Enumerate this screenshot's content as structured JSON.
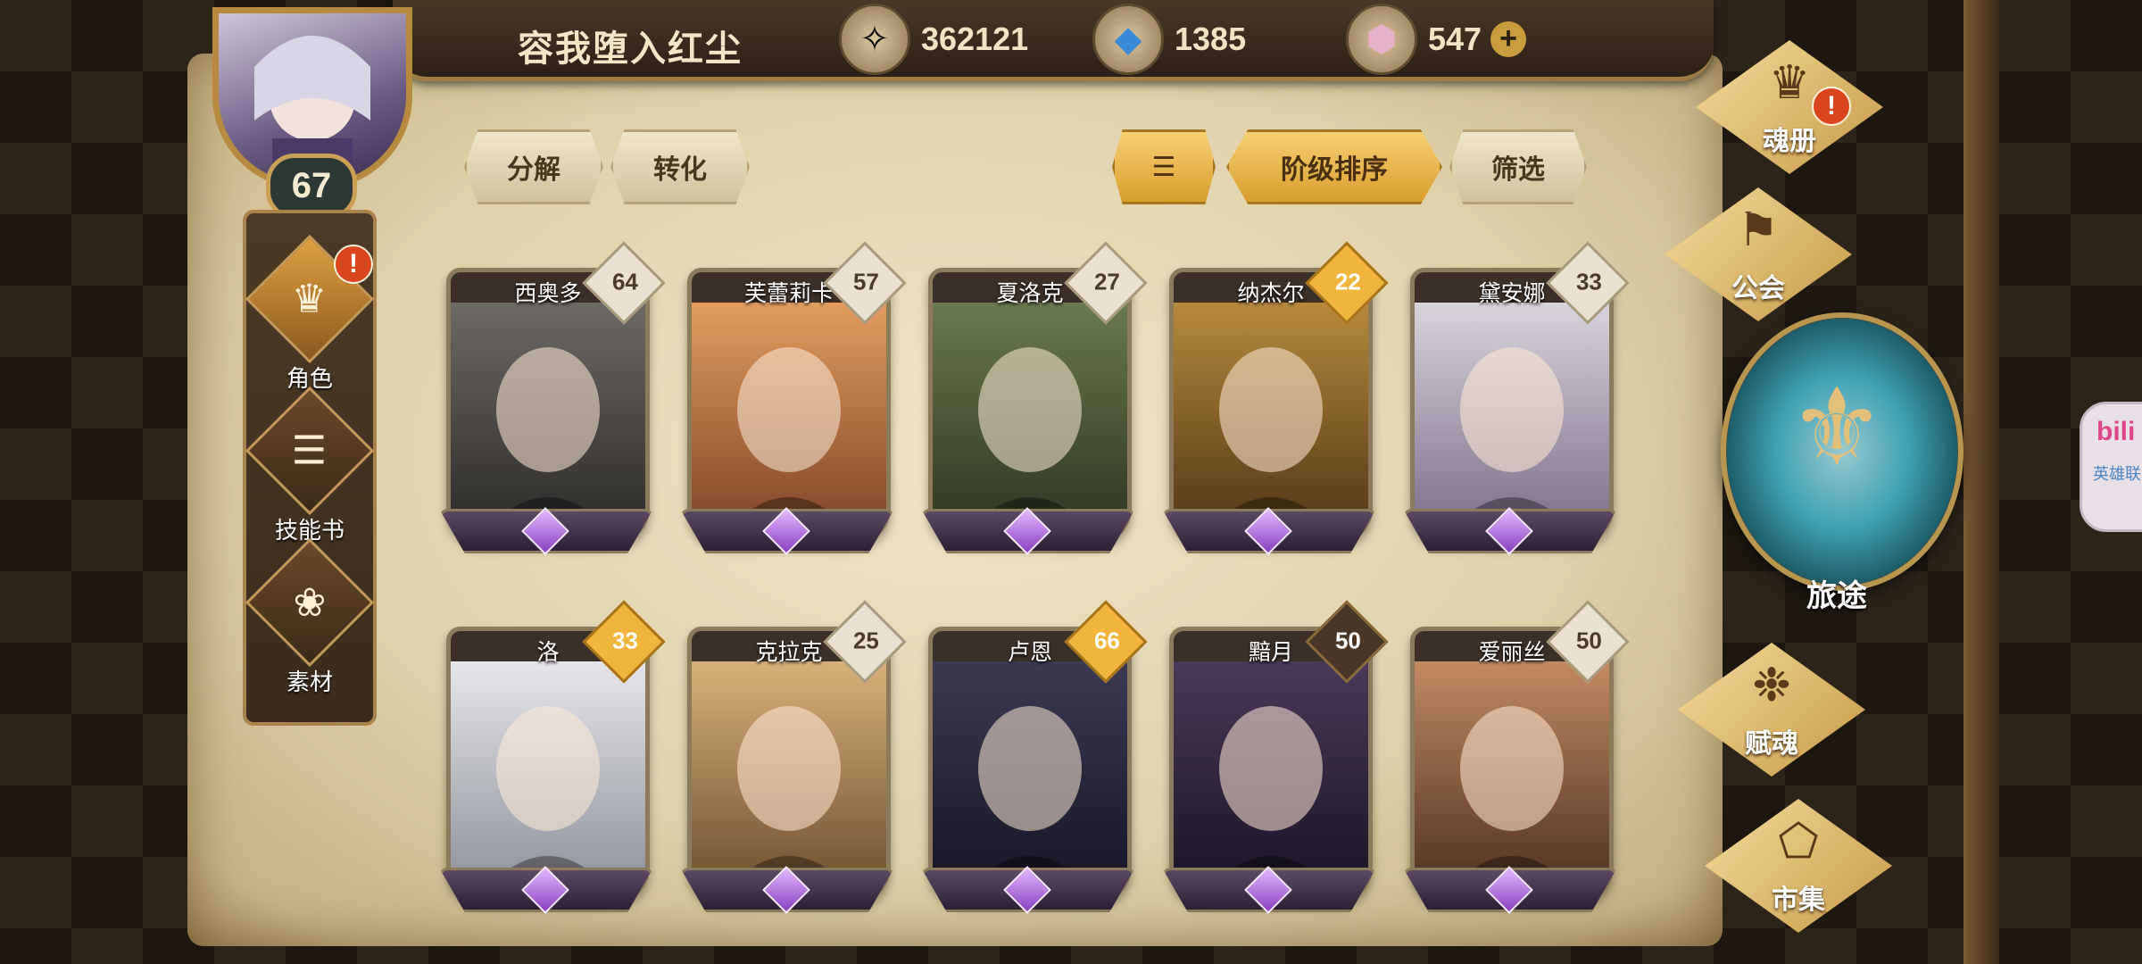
{
  "player": {
    "name": "容我堕入红尘",
    "level": "67"
  },
  "resources": [
    {
      "icon": "gold-coin-icon",
      "value": "362121"
    },
    {
      "icon": "blue-crystal-icon",
      "value": "1385"
    },
    {
      "icon": "pink-gem-icon",
      "value": "547"
    }
  ],
  "left_nav": [
    {
      "label": "角色",
      "icon": "helmet-icon",
      "alert": "!"
    },
    {
      "label": "技能书",
      "icon": "skill-book-icon"
    },
    {
      "label": "素材",
      "icon": "material-icon"
    }
  ],
  "toolbar": {
    "decompose": "分解",
    "convert": "转化",
    "sort_tier": "阶级排序",
    "filter": "筛选"
  },
  "cards": [
    {
      "name": "西奥多",
      "level": "64",
      "badge": "silver"
    },
    {
      "name": "芙蕾莉卡",
      "level": "57",
      "badge": "silver"
    },
    {
      "name": "夏洛克",
      "level": "27",
      "badge": "silver"
    },
    {
      "name": "纳杰尔",
      "level": "22",
      "badge": "gold"
    },
    {
      "name": "黛安娜",
      "level": "33",
      "badge": "silver"
    },
    {
      "name": "洛",
      "level": "33",
      "badge": "gold"
    },
    {
      "name": "克拉克",
      "level": "25",
      "badge": "silver"
    },
    {
      "name": "卢恩",
      "level": "66",
      "badge": "gold"
    },
    {
      "name": "黯月",
      "level": "50",
      "badge": "dark"
    },
    {
      "name": "爱丽丝",
      "level": "50",
      "badge": "silver"
    }
  ],
  "right_menu": {
    "soul_book": "魂册",
    "soul_book_alert": "!",
    "guild": "公会",
    "journey": "旅途",
    "endow_soul": "赋魂",
    "market": "市集"
  },
  "side_tab": {
    "line1": "bili",
    "line2": "英雄联"
  },
  "colors": {
    "accent_gold": "#f0b53a",
    "parchment": "#e2d3ad",
    "frame_dark": "#3b3028",
    "purple_gem": "#8a3fc1"
  }
}
